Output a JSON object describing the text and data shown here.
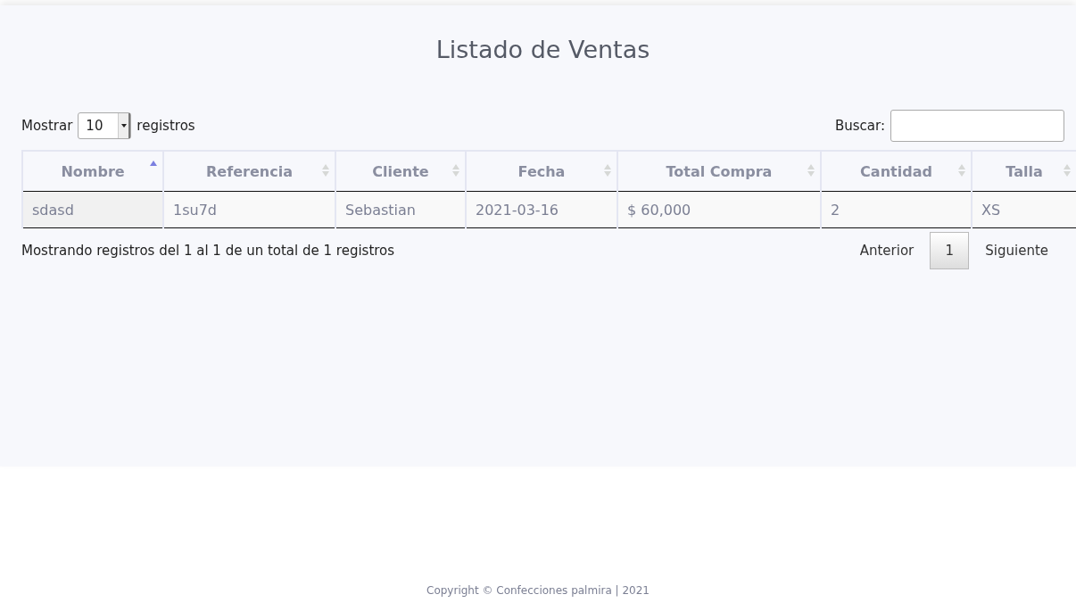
{
  "title": "Listado de Ventas",
  "length": {
    "before": "Mostrar",
    "value": "10",
    "after": "registros"
  },
  "search": {
    "label": "Buscar:"
  },
  "table": {
    "columns": [
      {
        "label": "Nombre",
        "sorted": true
      },
      {
        "label": "Referencia",
        "sorted": false
      },
      {
        "label": "Cliente",
        "sorted": false
      },
      {
        "label": "Fecha",
        "sorted": false
      },
      {
        "label": "Total Compra",
        "sorted": false
      },
      {
        "label": "Cantidad",
        "sorted": false
      },
      {
        "label": "Talla",
        "sorted": false
      }
    ],
    "rows": [
      [
        "sdasd",
        "1su7d",
        "Sebastian",
        "2021-03-16",
        "$ 60,000",
        "2",
        "XS"
      ]
    ]
  },
  "info": "Mostrando registros del 1 al 1 de un total de 1 registros",
  "pagination": {
    "previous": "Anterior",
    "pages": [
      {
        "label": "1",
        "selected": true
      }
    ],
    "next": "Siguiente"
  },
  "footer": "Copyright © Confecciones palmira | 2021"
}
